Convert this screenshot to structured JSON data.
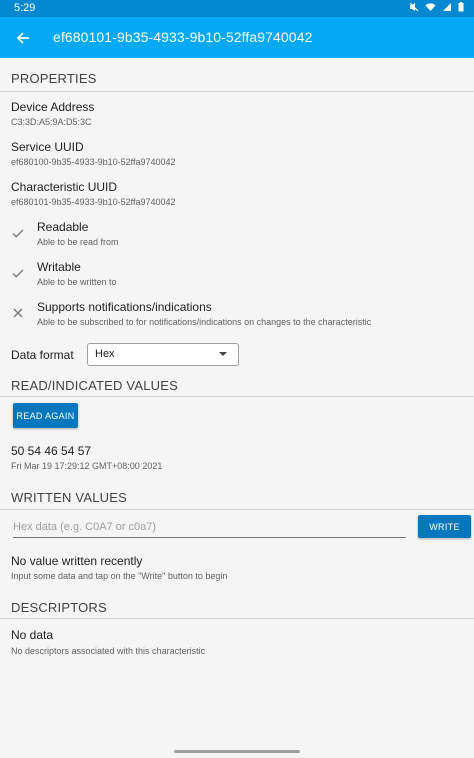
{
  "status_bar": {
    "time": "5:29"
  },
  "app_bar": {
    "title": "ef680101-9b35-4933-9b10-52ffa9740042"
  },
  "properties": {
    "header": "PROPERTIES",
    "device_address_label": "Device Address",
    "device_address": "C3:3D:A5:9A:D5:3C",
    "service_uuid_label": "Service UUID",
    "service_uuid": "ef680100-9b35-4933-9b10-52ffa9740042",
    "characteristic_uuid_label": "Characteristic UUID",
    "characteristic_uuid": "ef680101-9b35-4933-9b10-52ffa9740042",
    "capabilities": [
      {
        "title": "Readable",
        "subtitle": "Able to be read from",
        "icon": "check-icon"
      },
      {
        "title": "Writable",
        "subtitle": "Able to be written to",
        "icon": "check-icon"
      },
      {
        "title": "Supports notifications/indications",
        "subtitle": "Able to be subscribed to for notifications/indications on changes to the characteristic",
        "icon": "close-icon"
      }
    ]
  },
  "data_format": {
    "label": "Data format",
    "selected": "Hex"
  },
  "read_values": {
    "header": "READ/INDICATED VALUES",
    "button": "READ AGAIN",
    "value": "50 54 46 54 57",
    "timestamp": "Fri Mar 19 17:29:12 GMT+08:00 2021"
  },
  "written_values": {
    "header": "WRITTEN VALUES",
    "placeholder": "Hex data (e.g. C0A7 or c0a7)",
    "button": "WRITE",
    "empty_title": "No value written recently",
    "empty_subtitle": "Input some data and tap on the \"Write\" button to begin"
  },
  "descriptors": {
    "header": "DESCRIPTORS",
    "empty_title": "No data",
    "empty_subtitle": "No descriptors associated with this characteristic"
  },
  "colors": {
    "status_bar": "#0288d1",
    "app_bar": "#03a9f4",
    "button": "#0277bd"
  }
}
